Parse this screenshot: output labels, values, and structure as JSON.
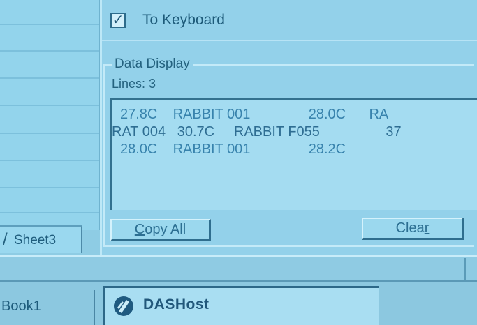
{
  "options": {
    "to_keyboard": {
      "label": "To Keyboard",
      "checked": true,
      "check_glyph": "✓"
    }
  },
  "data_display": {
    "title": "Data Display",
    "lines_label": "Lines: 3",
    "lines": [
      "27.8C    RABBIT 001               28.0C      RA",
      "RAT 004   30.7C     RABBIT F055                 37",
      "28.0C    RABBIT 001               28.2C"
    ]
  },
  "buttons": {
    "copy_all": {
      "label_underlined": "C",
      "label_rest": "opy All"
    },
    "clear": {
      "label_start": "Clea",
      "label_underlined": "r"
    }
  },
  "sheet_tab": {
    "label": "Sheet3",
    "slash": "/"
  },
  "taskbar": {
    "items": [
      {
        "label": "Book1"
      },
      {
        "label": "DASHost",
        "icon": "dashost-icon"
      }
    ]
  },
  "colors": {
    "screen_tint": "#8ecce4",
    "text_blue": "#3883ad",
    "dark_text": "#1d5a79"
  }
}
